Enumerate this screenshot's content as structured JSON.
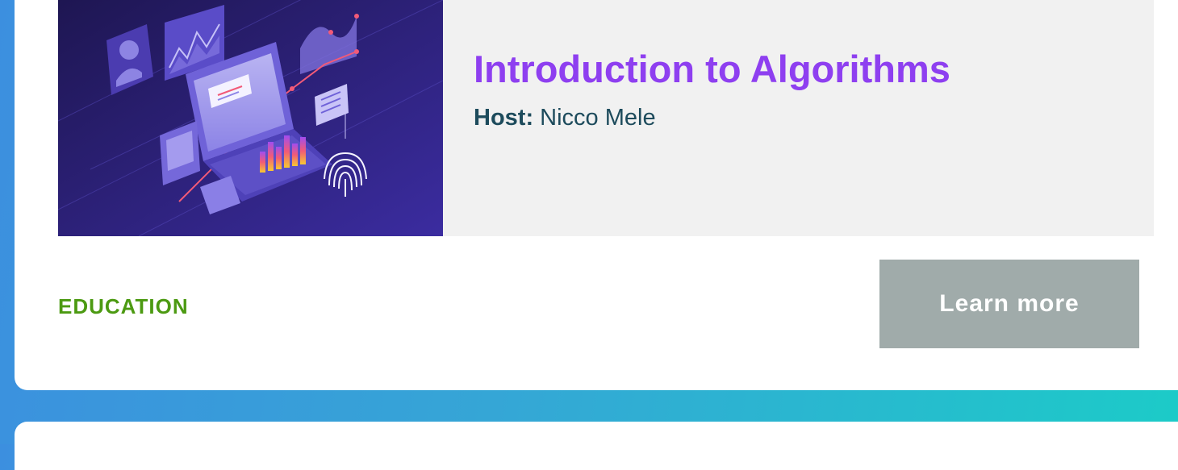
{
  "card": {
    "title": "Introduction to Algorithms",
    "host_label": "Host:",
    "host_name": "Nicco Mele",
    "category": "EDUCATION",
    "cta_label": "Learn more"
  },
  "colors": {
    "title": "#8e3ff0",
    "host_text": "#1d4b5c",
    "category": "#4c9a12",
    "button_bg": "#a0abaa",
    "feature_bg": "#f1f1f1",
    "page_gradient_start": "#3c8fdf",
    "page_gradient_end": "#1ccbc8"
  },
  "icons": {
    "thumbnail": "isometric-laptop-analytics-illustration",
    "avatar": "user-avatar-icon",
    "fingerprint": "fingerprint-icon"
  }
}
